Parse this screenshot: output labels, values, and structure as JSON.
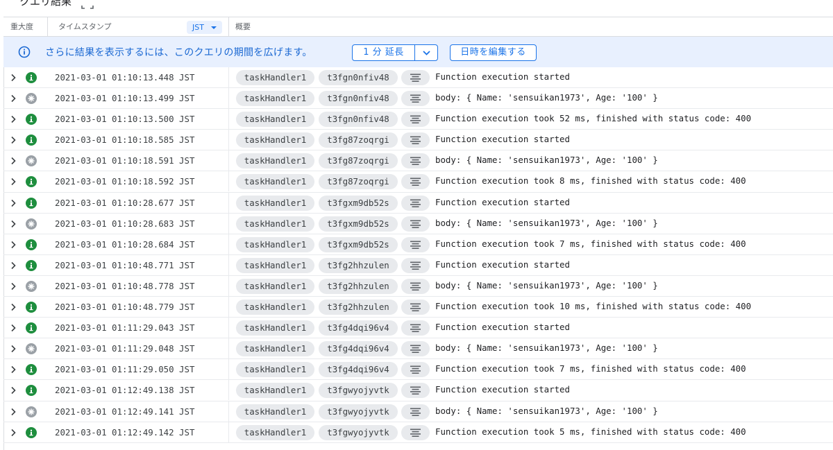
{
  "title": "クエリ結果",
  "header": {
    "severity": "重大度",
    "timestamp": "タイムスタンプ",
    "timezone": "JST",
    "summary": "概要"
  },
  "banner": {
    "text": "さらに結果を表示するには、このクエリの期間を広げます。",
    "extend_label": "1 分 延長",
    "edit_label": "日時を編集する"
  },
  "colors": {
    "info_severity": "#1e8e3e",
    "debug_severity": "#9aa0a6",
    "accent": "#1a73e8",
    "banner_bg": "#e8f0fe"
  },
  "rows": [
    {
      "severity": "info",
      "timestamp": "2021-03-01 01:10:13.448 JST",
      "func": "taskHandler1",
      "exec_id": "t3fgn0nfiv48",
      "message": "Function execution started"
    },
    {
      "severity": "debug",
      "timestamp": "2021-03-01 01:10:13.499 JST",
      "func": "taskHandler1",
      "exec_id": "t3fgn0nfiv48",
      "message": "body: { Name: 'sensuikan1973', Age: '100' }"
    },
    {
      "severity": "info",
      "timestamp": "2021-03-01 01:10:13.500 JST",
      "func": "taskHandler1",
      "exec_id": "t3fgn0nfiv48",
      "message": "Function execution took 52 ms, finished with status code: 400"
    },
    {
      "severity": "info",
      "timestamp": "2021-03-01 01:10:18.585 JST",
      "func": "taskHandler1",
      "exec_id": "t3fg87zoqrgi",
      "message": "Function execution started"
    },
    {
      "severity": "debug",
      "timestamp": "2021-03-01 01:10:18.591 JST",
      "func": "taskHandler1",
      "exec_id": "t3fg87zoqrgi",
      "message": "body: { Name: 'sensuikan1973', Age: '100' }"
    },
    {
      "severity": "info",
      "timestamp": "2021-03-01 01:10:18.592 JST",
      "func": "taskHandler1",
      "exec_id": "t3fg87zoqrgi",
      "message": "Function execution took 8 ms, finished with status code: 400"
    },
    {
      "severity": "info",
      "timestamp": "2021-03-01 01:10:28.677 JST",
      "func": "taskHandler1",
      "exec_id": "t3fgxm9db52s",
      "message": "Function execution started"
    },
    {
      "severity": "debug",
      "timestamp": "2021-03-01 01:10:28.683 JST",
      "func": "taskHandler1",
      "exec_id": "t3fgxm9db52s",
      "message": "body: { Name: 'sensuikan1973', Age: '100' }"
    },
    {
      "severity": "info",
      "timestamp": "2021-03-01 01:10:28.684 JST",
      "func": "taskHandler1",
      "exec_id": "t3fgxm9db52s",
      "message": "Function execution took 7 ms, finished with status code: 400"
    },
    {
      "severity": "info",
      "timestamp": "2021-03-01 01:10:48.771 JST",
      "func": "taskHandler1",
      "exec_id": "t3fg2hhzulen",
      "message": "Function execution started"
    },
    {
      "severity": "debug",
      "timestamp": "2021-03-01 01:10:48.778 JST",
      "func": "taskHandler1",
      "exec_id": "t3fg2hhzulen",
      "message": "body: { Name: 'sensuikan1973', Age: '100' }"
    },
    {
      "severity": "info",
      "timestamp": "2021-03-01 01:10:48.779 JST",
      "func": "taskHandler1",
      "exec_id": "t3fg2hhzulen",
      "message": "Function execution took 10 ms, finished with status code: 400"
    },
    {
      "severity": "info",
      "timestamp": "2021-03-01 01:11:29.043 JST",
      "func": "taskHandler1",
      "exec_id": "t3fg4dqi96v4",
      "message": "Function execution started"
    },
    {
      "severity": "debug",
      "timestamp": "2021-03-01 01:11:29.048 JST",
      "func": "taskHandler1",
      "exec_id": "t3fg4dqi96v4",
      "message": "body: { Name: 'sensuikan1973', Age: '100' }"
    },
    {
      "severity": "info",
      "timestamp": "2021-03-01 01:11:29.050 JST",
      "func": "taskHandler1",
      "exec_id": "t3fg4dqi96v4",
      "message": "Function execution took 7 ms, finished with status code: 400"
    },
    {
      "severity": "info",
      "timestamp": "2021-03-01 01:12:49.138 JST",
      "func": "taskHandler1",
      "exec_id": "t3fgwyojyvtk",
      "message": "Function execution started"
    },
    {
      "severity": "debug",
      "timestamp": "2021-03-01 01:12:49.141 JST",
      "func": "taskHandler1",
      "exec_id": "t3fgwyojyvtk",
      "message": "body: { Name: 'sensuikan1973', Age: '100' }"
    },
    {
      "severity": "info",
      "timestamp": "2021-03-01 01:12:49.142 JST",
      "func": "taskHandler1",
      "exec_id": "t3fgwyojyvtk",
      "message": "Function execution took 5 ms, finished with status code: 400"
    }
  ]
}
